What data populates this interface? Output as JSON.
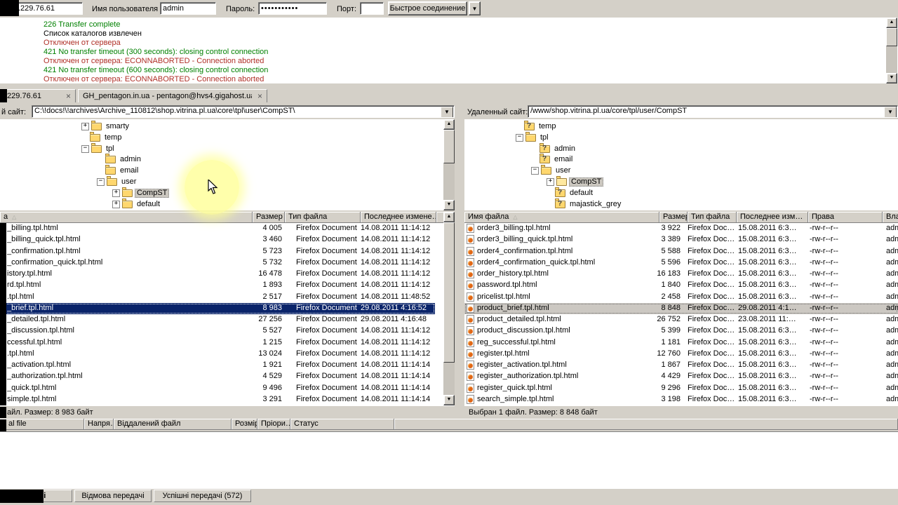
{
  "quickconnect": {
    "host_value": ".229.76.61",
    "username_label": "Имя пользователя",
    "username_value": "admin",
    "password_label": "Пароль:",
    "password_value": "•••••••••••",
    "port_label": "Порт:",
    "port_value": "",
    "connect_button": "Быстрое соединение",
    "dropdown_icon": "▼"
  },
  "log": {
    "colors": {
      "green": "#008000",
      "red": "#b03028",
      "black": "#000000"
    },
    "lines": [
      {
        "text": "226 Transfer complete",
        "color": "green"
      },
      {
        "text": "Список каталогов извлечен",
        "color": "black"
      },
      {
        "text": "Отключен от сервера",
        "color": "red"
      },
      {
        "text": "421 No transfer timeout (300 seconds): closing control connection",
        "color": "green"
      },
      {
        "text": "Отключен от сервера: ECONNABORTED - Connection aborted",
        "color": "red"
      },
      {
        "text": "421 No transfer timeout (600 seconds): closing control connection",
        "color": "green"
      },
      {
        "text": "Отключен от сервера: ECONNABORTED - Connection aborted",
        "color": "red"
      }
    ]
  },
  "tabs": [
    {
      "label": ".229.76.61",
      "close": "×"
    },
    {
      "label": "GH_pentagon.in.ua - pentagon@hvs4.gigahost.ua",
      "close": "×"
    }
  ],
  "local_panel": {
    "site_label": "й сайт:",
    "path": "C:\\!docs!\\!archives\\Archive_110812\\shop.vitrina.pl.ua\\core\\tpl\\user\\CompST\\",
    "tree": [
      {
        "label": "smarty",
        "indent": 0,
        "expander": "+",
        "icon": "folder"
      },
      {
        "label": "temp",
        "indent": 0,
        "expander": "",
        "icon": "folder"
      },
      {
        "label": "tpl",
        "indent": 0,
        "expander": "−",
        "icon": "folder"
      },
      {
        "label": "admin",
        "indent": 1,
        "expander": "",
        "icon": "folder"
      },
      {
        "label": "email",
        "indent": 1,
        "expander": "",
        "icon": "folder"
      },
      {
        "label": "user",
        "indent": 1,
        "expander": "−",
        "icon": "folder"
      },
      {
        "label": "CompST",
        "indent": 2,
        "expander": "+",
        "icon": "folder",
        "selected": true
      },
      {
        "label": "default",
        "indent": 2,
        "expander": "+",
        "icon": "folder"
      }
    ],
    "columns": [
      "а",
      "Размер",
      "Тип файла",
      "Последнее измене…"
    ],
    "files": [
      {
        "name": "_billing.tpl.html",
        "size": "4 005",
        "type": "Firefox Document",
        "modified": "14.08.2011 11:14:12"
      },
      {
        "name": "_billing_quick.tpl.html",
        "size": "3 460",
        "type": "Firefox Document",
        "modified": "14.08.2011 11:14:12"
      },
      {
        "name": "_confirmation.tpl.html",
        "size": "5 723",
        "type": "Firefox Document",
        "modified": "14.08.2011 11:14:12"
      },
      {
        "name": "_confirmation_quick.tpl.html",
        "size": "5 732",
        "type": "Firefox Document",
        "modified": "14.08.2011 11:14:12"
      },
      {
        "name": "istory.tpl.html",
        "size": "16 478",
        "type": "Firefox Document",
        "modified": "14.08.2011 11:14:12"
      },
      {
        "name": "rd.tpl.html",
        "size": "1 893",
        "type": "Firefox Document",
        "modified": "14.08.2011 11:14:12"
      },
      {
        "name": ".tpl.html",
        "size": "2 517",
        "type": "Firefox Document",
        "modified": "14.08.2011 11:48:52"
      },
      {
        "name": "_brief.tpl.html",
        "size": "8 983",
        "type": "Firefox Document",
        "modified": "29.08.2011 4:16:52",
        "selected": "active"
      },
      {
        "name": "_detailed.tpl.html",
        "size": "27 256",
        "type": "Firefox Document",
        "modified": "29.08.2011 4:16:48"
      },
      {
        "name": "_discussion.tpl.html",
        "size": "5 527",
        "type": "Firefox Document",
        "modified": "14.08.2011 11:14:12"
      },
      {
        "name": "ccessful.tpl.html",
        "size": "1 215",
        "type": "Firefox Document",
        "modified": "14.08.2011 11:14:12"
      },
      {
        "name": ".tpl.html",
        "size": "13 024",
        "type": "Firefox Document",
        "modified": "14.08.2011 11:14:12"
      },
      {
        "name": "_activation.tpl.html",
        "size": "1 921",
        "type": "Firefox Document",
        "modified": "14.08.2011 11:14:14"
      },
      {
        "name": "_authorization.tpl.html",
        "size": "4 529",
        "type": "Firefox Document",
        "modified": "14.08.2011 11:14:14"
      },
      {
        "name": "_quick.tpl.html",
        "size": "9 496",
        "type": "Firefox Document",
        "modified": "14.08.2011 11:14:14"
      },
      {
        "name": "simple.tpl.html",
        "size": "3 291",
        "type": "Firefox Document",
        "modified": "14.08.2011 11:14:14"
      }
    ],
    "status": "айл. Размер: 8 983 байт"
  },
  "remote_panel": {
    "site_label": "Удаленный сайт:",
    "path": "/www/shop.vitrina.pl.ua/core/tpl/user/CompST",
    "tree": [
      {
        "label": "temp",
        "indent": 0,
        "expander": "",
        "icon": "folder-q"
      },
      {
        "label": "tpl",
        "indent": 0,
        "expander": "−",
        "icon": "folder"
      },
      {
        "label": "admin",
        "indent": 1,
        "expander": "",
        "icon": "folder-q"
      },
      {
        "label": "email",
        "indent": 1,
        "expander": "",
        "icon": "folder-q"
      },
      {
        "label": "user",
        "indent": 1,
        "expander": "−",
        "icon": "folder"
      },
      {
        "label": "CompST",
        "indent": 2,
        "expander": "+",
        "icon": "folder-open",
        "selected": true
      },
      {
        "label": "default",
        "indent": 2,
        "expander": "",
        "icon": "folder-q"
      },
      {
        "label": "majastick_grey",
        "indent": 2,
        "expander": "",
        "icon": "folder-q"
      }
    ],
    "columns": [
      "Имя файла",
      "Размер",
      "Тип файла",
      "Последнее изм…",
      "Права",
      "Вла…"
    ],
    "files": [
      {
        "name": "order3_billing.tpl.html",
        "size": "3 922",
        "type": "Firefox Doc…",
        "modified": "15.08.2011 6:3…",
        "perms": "-rw-r--r--",
        "owner": "adm"
      },
      {
        "name": "order3_billing_quick.tpl.html",
        "size": "3 389",
        "type": "Firefox Doc…",
        "modified": "15.08.2011 6:3…",
        "perms": "-rw-r--r--",
        "owner": "adm"
      },
      {
        "name": "order4_confirmation.tpl.html",
        "size": "5 588",
        "type": "Firefox Doc…",
        "modified": "15.08.2011 6:3…",
        "perms": "-rw-r--r--",
        "owner": "adm"
      },
      {
        "name": "order4_confirmation_quick.tpl.html",
        "size": "5 596",
        "type": "Firefox Doc…",
        "modified": "15.08.2011 6:3…",
        "perms": "-rw-r--r--",
        "owner": "adm"
      },
      {
        "name": "order_history.tpl.html",
        "size": "16 183",
        "type": "Firefox Doc…",
        "modified": "15.08.2011 6:3…",
        "perms": "-rw-r--r--",
        "owner": "adm"
      },
      {
        "name": "password.tpl.html",
        "size": "1 840",
        "type": "Firefox Doc…",
        "modified": "15.08.2011 6:3…",
        "perms": "-rw-r--r--",
        "owner": "adm"
      },
      {
        "name": "pricelist.tpl.html",
        "size": "2 458",
        "type": "Firefox Doc…",
        "modified": "15.08.2011 6:3…",
        "perms": "-rw-r--r--",
        "owner": "adm"
      },
      {
        "name": "product_brief.tpl.html",
        "size": "8 848",
        "type": "Firefox Doc…",
        "modified": "29.08.2011 4:1…",
        "perms": "-rw-r--r--",
        "owner": "adm",
        "selected": "inactive"
      },
      {
        "name": "product_detailed.tpl.html",
        "size": "26 752",
        "type": "Firefox Doc…",
        "modified": "23.08.2011 11:…",
        "perms": "-rw-r--r--",
        "owner": "adm"
      },
      {
        "name": "product_discussion.tpl.html",
        "size": "5 399",
        "type": "Firefox Doc…",
        "modified": "15.08.2011 6:3…",
        "perms": "-rw-r--r--",
        "owner": "adm"
      },
      {
        "name": "reg_successful.tpl.html",
        "size": "1 181",
        "type": "Firefox Doc…",
        "modified": "15.08.2011 6:3…",
        "perms": "-rw-r--r--",
        "owner": "adm"
      },
      {
        "name": "register.tpl.html",
        "size": "12 760",
        "type": "Firefox Doc…",
        "modified": "15.08.2011 6:3…",
        "perms": "-rw-r--r--",
        "owner": "adm"
      },
      {
        "name": "register_activation.tpl.html",
        "size": "1 867",
        "type": "Firefox Doc…",
        "modified": "15.08.2011 6:3…",
        "perms": "-rw-r--r--",
        "owner": "adm"
      },
      {
        "name": "register_authorization.tpl.html",
        "size": "4 429",
        "type": "Firefox Doc…",
        "modified": "15.08.2011 6:3…",
        "perms": "-rw-r--r--",
        "owner": "adm"
      },
      {
        "name": "register_quick.tpl.html",
        "size": "9 296",
        "type": "Firefox Doc…",
        "modified": "15.08.2011 6:3…",
        "perms": "-rw-r--r--",
        "owner": "adm"
      },
      {
        "name": "search_simple.tpl.html",
        "size": "3 198",
        "type": "Firefox Doc…",
        "modified": "15.08.2011 6:3…",
        "perms": "-rw-r--r--",
        "owner": "adm"
      }
    ],
    "status": "Выбран 1 файл. Размер: 8 848 байт"
  },
  "queue": {
    "columns": [
      "al file",
      "Напря…",
      "Віддалений файл",
      "Розмір",
      "Пріори…",
      "Статус"
    ]
  },
  "bottom_tabs": [
    {
      "label": "черзі",
      "active": true
    },
    {
      "label": "Відмова передачі"
    },
    {
      "label": "Успішні передачі (572)"
    }
  ]
}
